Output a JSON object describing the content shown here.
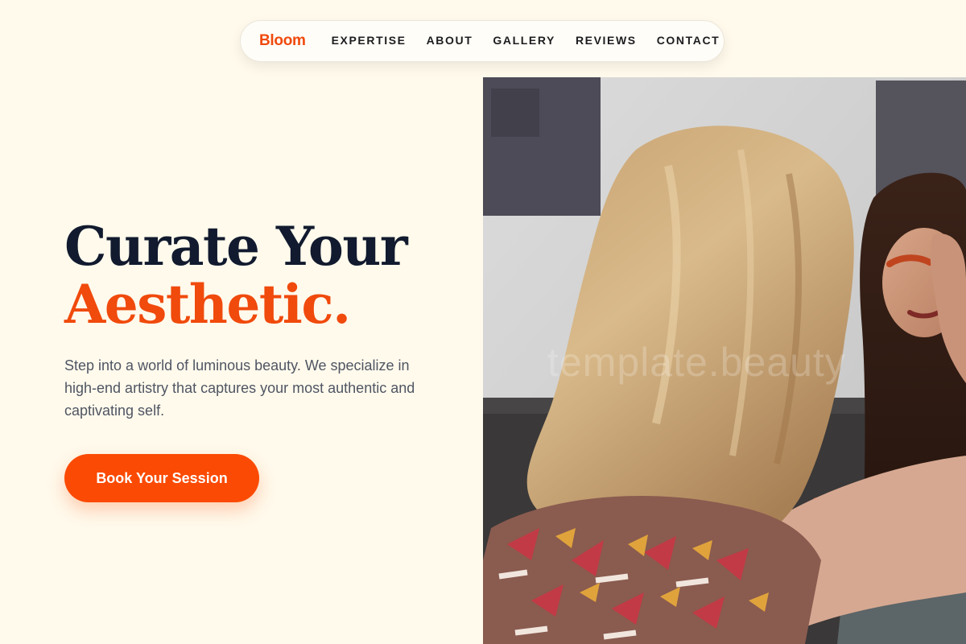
{
  "nav": {
    "brand": "Bloom",
    "links": [
      "EXPERTISE",
      "ABOUT",
      "GALLERY",
      "REVIEWS",
      "CONTACT"
    ]
  },
  "hero": {
    "title_line1": "Curate Your",
    "title_line2": "Aesthetic.",
    "description": "Step into a world of luminous beauty. We specialize in high-end artistry that captures your most authentic and captivating self.",
    "cta_label": "Book Your Session",
    "image_watermark": "template.beauty"
  },
  "colors": {
    "background": "#fffaec",
    "accent": "#f04a0c",
    "button": "#fb4a03",
    "heading": "#111a2e",
    "body_text": "#4f5563"
  },
  "icons": {
    "hero_image": "makeup-artist-photo"
  }
}
